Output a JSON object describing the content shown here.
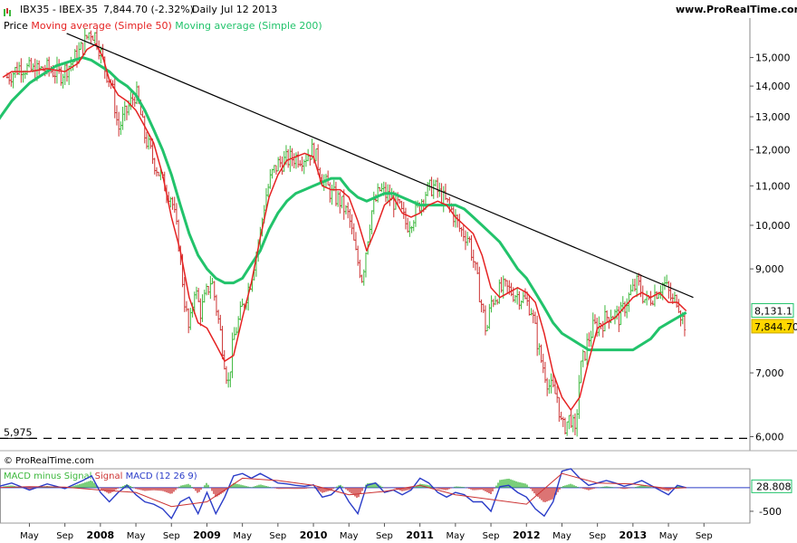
{
  "header": {
    "symbol": "IBX35 - IBEX-35",
    "last_change": "7,844.70 (-2.32%)",
    "period": "Daily",
    "date": "Jul 12 2013",
    "site": "www.ProRealTime.com"
  },
  "legend": {
    "price": "Price",
    "ma50": "Moving average (Simple 50)",
    "ma200": "Moving average (Simple 200)"
  },
  "copyright": "© ProRealTime.com",
  "macd_legend": {
    "hist": "MACD minus Signal",
    "signal": "Signal",
    "macd": "MACD (12 26 9)"
  },
  "colors": {
    "up": "#3cb83c",
    "down": "#cc3333",
    "ma50": "#e52222",
    "ma200": "#22c36b",
    "trend": "#000000",
    "macd": "#2a3cc8",
    "signal": "#cc3333"
  },
  "chart_data": [
    {
      "type": "line",
      "title": "",
      "y_scale": "log",
      "ylim": [
        5800,
        16500
      ],
      "y_ticks": [
        "15,000",
        "14,000",
        "13,000",
        "12,000",
        "11,000",
        "10,000",
        "9,000",
        "7,000",
        "6,000"
      ],
      "y_tick_values": [
        15000,
        14000,
        13000,
        12000,
        11000,
        10000,
        9000,
        7000,
        6000
      ],
      "x_ticks": [
        "May",
        "Sep",
        "2008",
        "May",
        "Sep",
        "2009",
        "May",
        "Sep",
        "2010",
        "May",
        "Sep",
        "2011",
        "May",
        "Sep",
        "2012",
        "May",
        "Sep",
        "2013",
        "May",
        "Sep"
      ],
      "x_tick_months": [
        4,
        8,
        12,
        16,
        20,
        24,
        28,
        32,
        36,
        40,
        44,
        48,
        52,
        56,
        60,
        64,
        68,
        72,
        76,
        80
      ],
      "x_unit": "months since Jan 2007",
      "series": [
        {
          "name": "Price",
          "x": [
            1.5,
            3,
            4.5,
            6,
            7.5,
            9,
            10,
            10.8,
            11.5,
            12.5,
            13.3,
            14,
            15,
            16,
            17,
            18,
            19,
            20,
            20.8,
            21.5,
            22,
            22.6,
            23.3,
            24.5,
            26,
            26.4,
            27,
            28,
            29,
            30,
            30.6,
            31.3,
            32,
            32.9,
            34,
            35,
            36,
            37,
            38,
            39,
            40,
            40.8,
            41.5,
            42.5,
            43.5,
            44.5,
            45.5,
            46.5,
            47.5,
            48.5,
            49.5,
            50.5,
            51.5,
            52.5,
            53.5,
            54.5,
            55.5,
            56,
            56.8,
            57.5,
            58.5,
            59.5,
            60.5,
            61.5,
            62.5,
            63.5,
            64,
            65,
            65.5,
            66,
            67,
            67.5,
            68.5,
            69.5,
            70.5,
            71.5,
            72.5,
            73.5,
            74.5,
            75.5,
            76.5,
            77,
            77.5,
            78
          ],
          "values": [
            14300,
            14700,
            14500,
            14600,
            14400,
            14900,
            15400,
            16000,
            15800,
            14600,
            14000,
            12600,
            13200,
            13800,
            12400,
            11700,
            11100,
            10700,
            9600,
            8300,
            7700,
            8600,
            8100,
            8800,
            7200,
            6800,
            7600,
            8200,
            8800,
            9800,
            10700,
            11300,
            11600,
            11700,
            11800,
            11800,
            12000,
            11200,
            10800,
            10600,
            10200,
            9300,
            8800,
            10300,
            10900,
            10700,
            10500,
            10000,
            10300,
            10800,
            11000,
            10700,
            10400,
            9900,
            9700,
            8700,
            7700,
            8300,
            8500,
            8600,
            8500,
            8400,
            8200,
            7300,
            6800,
            6600,
            6100,
            6300,
            6000,
            7000,
            7600,
            7800,
            7900,
            8100,
            8000,
            8400,
            8700,
            8300,
            8500,
            8700,
            8300,
            8400,
            8000,
            7844.7
          ]
        },
        {
          "name": "Moving average (Simple 50)",
          "x": [
            1,
            2,
            4,
            6,
            8,
            9.5,
            10.5,
            11.5,
            12.3,
            13,
            14,
            15,
            16,
            17,
            18,
            19,
            20,
            21,
            22,
            23,
            24,
            25,
            26,
            27,
            28,
            29,
            30,
            31,
            32,
            33,
            34,
            35,
            36,
            37,
            38,
            39,
            40,
            41,
            42,
            43,
            44,
            45,
            46,
            47,
            48,
            49,
            50,
            51,
            52,
            53,
            54,
            55,
            56,
            57,
            58,
            59,
            60,
            61,
            62,
            63,
            64,
            65,
            66,
            67,
            68,
            69,
            70,
            71,
            72,
            73,
            74,
            75,
            76,
            77,
            78
          ],
          "values": [
            14300,
            14500,
            14500,
            14600,
            14500,
            14800,
            15300,
            15500,
            15000,
            14200,
            13700,
            13500,
            13200,
            12700,
            12200,
            11300,
            10200,
            9400,
            8400,
            7900,
            7800,
            7500,
            7200,
            7300,
            8000,
            8700,
            9700,
            10700,
            11300,
            11700,
            11800,
            11900,
            11800,
            11000,
            10900,
            10900,
            10700,
            10100,
            9400,
            9900,
            10500,
            10700,
            10300,
            10200,
            10300,
            10500,
            10600,
            10500,
            10200,
            10000,
            9800,
            9300,
            8600,
            8400,
            8500,
            8600,
            8500,
            8300,
            7700,
            7000,
            6600,
            6400,
            6600,
            7200,
            7800,
            7900,
            8000,
            8200,
            8400,
            8500,
            8400,
            8500,
            8300,
            8300,
            8131.1
          ]
        },
        {
          "name": "Moving average (Simple 200)",
          "x": [
            0,
            1,
            2,
            3,
            4,
            5,
            6,
            7,
            8,
            9,
            10,
            11,
            12,
            13,
            14,
            15,
            16,
            17,
            18,
            19,
            20,
            21,
            22,
            23,
            24,
            25,
            26,
            27,
            28,
            29,
            30,
            31,
            32,
            33,
            34,
            35,
            36,
            37,
            38,
            39,
            40,
            41,
            42,
            43,
            44,
            45,
            46,
            47,
            48,
            49,
            50,
            51,
            52,
            53,
            54,
            55,
            56,
            57,
            58,
            59,
            60,
            61,
            62,
            63,
            64,
            65,
            66,
            67,
            68,
            69,
            70,
            71,
            72,
            73,
            74,
            75,
            76,
            77,
            78
          ],
          "values": [
            12700,
            13100,
            13500,
            13800,
            14100,
            14300,
            14500,
            14700,
            14800,
            14900,
            15000,
            14900,
            14700,
            14500,
            14200,
            14000,
            13700,
            13200,
            12600,
            12000,
            11300,
            10500,
            9800,
            9300,
            9000,
            8800,
            8700,
            8700,
            8800,
            9100,
            9400,
            9900,
            10300,
            10600,
            10800,
            10900,
            11000,
            11100,
            11200,
            11200,
            10900,
            10700,
            10600,
            10700,
            10800,
            10800,
            10700,
            10600,
            10500,
            10500,
            10500,
            10500,
            10500,
            10400,
            10200,
            10000,
            9800,
            9600,
            9300,
            9000,
            8800,
            8500,
            8200,
            7900,
            7700,
            7600,
            7500,
            7400,
            7400,
            7400,
            7400,
            7400,
            7400,
            7500,
            7600,
            7800,
            7900,
            8000,
            8100
          ]
        }
      ],
      "trendline": {
        "x": [
          8.2,
          78.8
        ],
        "y": [
          15900,
          8400
        ]
      },
      "hline": {
        "value": 5975,
        "label": "5,975"
      },
      "last_value_labels": [
        "8,131.1",
        "7,844.70"
      ]
    },
    {
      "type": "line",
      "title": "",
      "y_ticks": [
        "28.808",
        "-500"
      ],
      "y_tick_values": [
        28.808,
        -500
      ],
      "ylim": [
        -750,
        400
      ],
      "series": [
        {
          "name": "MACD (12 26 9)",
          "x": [
            0,
            2,
            4,
            6,
            8,
            10,
            11,
            12,
            13,
            14,
            15,
            16,
            17,
            18,
            19,
            20,
            21,
            22,
            23,
            24,
            25,
            26,
            27,
            28,
            29,
            30,
            31,
            32,
            33,
            34,
            35,
            36,
            37,
            38,
            39,
            40,
            41,
            42,
            43,
            44,
            45,
            46,
            47,
            48,
            49,
            50,
            51,
            52,
            53,
            54,
            55,
            56,
            57,
            58,
            59,
            60,
            61,
            62,
            63,
            64,
            65,
            66,
            67,
            68,
            69,
            70,
            71,
            72,
            73,
            74,
            75,
            76,
            77,
            78
          ],
          "values": [
            0,
            100,
            -50,
            80,
            -20,
            150,
            250,
            -100,
            -300,
            -100,
            50,
            -150,
            -300,
            -350,
            -450,
            -650,
            -300,
            -200,
            -550,
            -100,
            -550,
            -200,
            250,
            300,
            200,
            300,
            200,
            100,
            80,
            50,
            30,
            60,
            -200,
            -150,
            20,
            -300,
            -550,
            50,
            100,
            -100,
            -50,
            -150,
            -50,
            200,
            100,
            -100,
            -200,
            -100,
            -150,
            -300,
            -300,
            -500,
            20,
            50,
            -100,
            -200,
            -450,
            -600,
            -300,
            350,
            400,
            200,
            50,
            100,
            150,
            100,
            30,
            80,
            150,
            50,
            -50,
            -150,
            50,
            0
          ]
        },
        {
          "name": "Signal",
          "x": [
            0,
            4,
            8,
            12,
            16,
            20,
            24,
            28,
            32,
            36,
            40,
            44,
            48,
            52,
            56,
            60,
            64,
            68,
            72,
            76,
            78
          ],
          "values": [
            0,
            20,
            10,
            -50,
            -100,
            -400,
            -300,
            200,
            150,
            50,
            -150,
            -80,
            50,
            -150,
            -250,
            -350,
            300,
            100,
            80,
            -20,
            0
          ]
        }
      ]
    }
  ]
}
